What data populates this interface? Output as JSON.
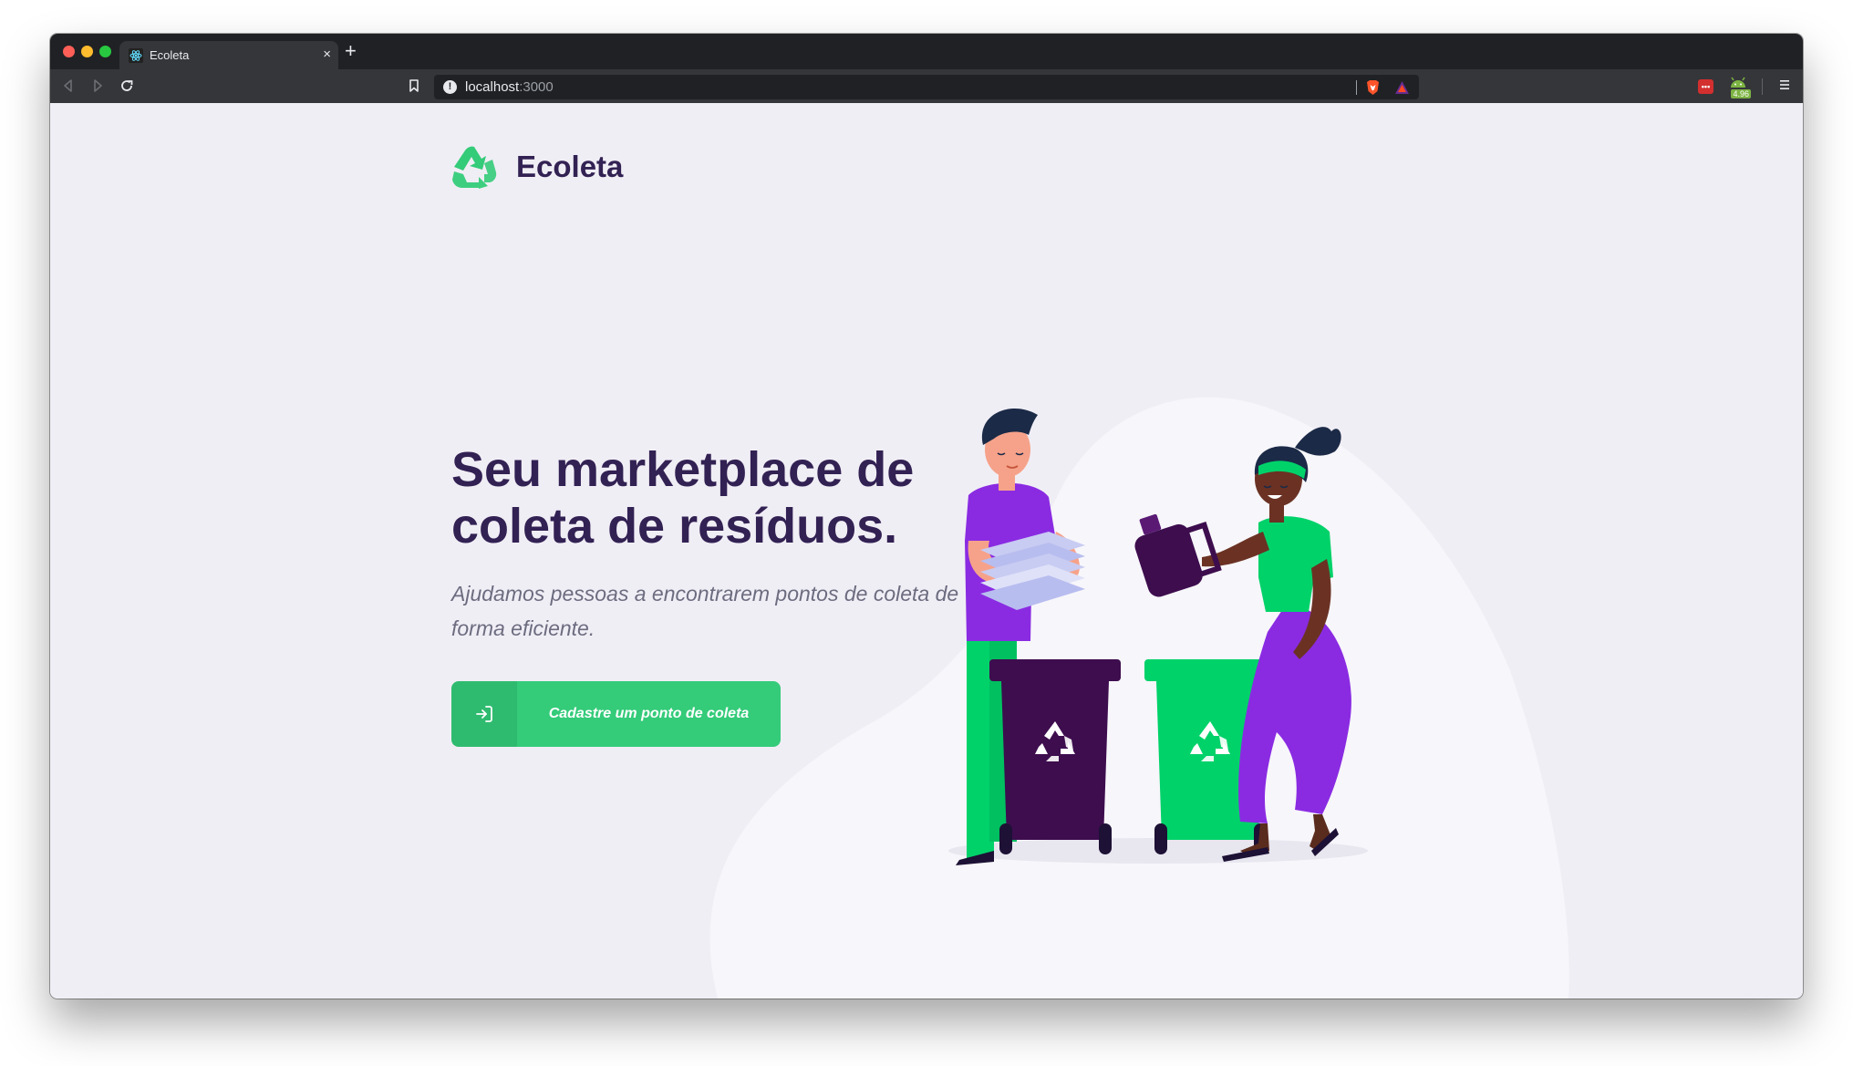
{
  "browser": {
    "tab": {
      "title": "Ecoleta",
      "close_glyph": "×",
      "favicon": "react-icon"
    },
    "new_tab_glyph": "+",
    "address": {
      "host": "localhost",
      "port": ":3000",
      "info_glyph": "!"
    },
    "extensions": {
      "ext1_label": "•••",
      "ext2_badge": "4.96"
    },
    "icons": [
      "back-icon",
      "forward-icon",
      "reload-icon",
      "bookmark-icon",
      "info-icon",
      "brave-shields-icon",
      "brave-rewards-icon",
      "menu-icon"
    ]
  },
  "page": {
    "brand": "Ecoleta",
    "hero": {
      "title": "Seu marketplace de coleta de resíduos.",
      "subtitle": "Ajudamos pessoas a encontrarem pontos de coleta de forma eficiente."
    },
    "cta": {
      "label": "Cadastre um ponto de coleta",
      "icon": "log-in-icon"
    },
    "colors": {
      "primary": "#34CB79",
      "title": "#322153",
      "text": "#6C6C80",
      "background": "#F0EEF5",
      "bin_purple": "#3D0D4E",
      "bin_green": "#00D26A"
    },
    "illustration": "people-recycling-illustration"
  }
}
